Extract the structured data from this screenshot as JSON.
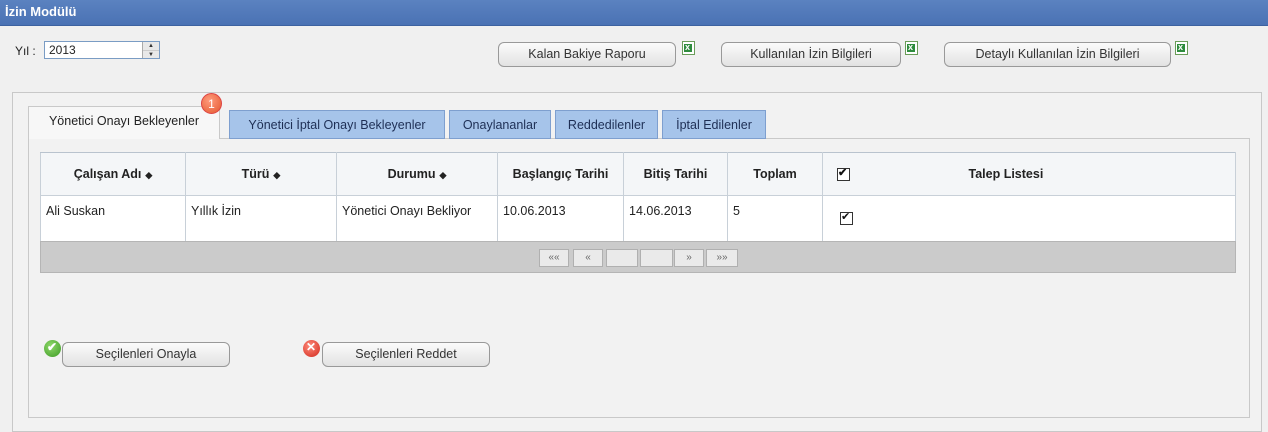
{
  "window": {
    "title": "İzin Modülü"
  },
  "filters": {
    "year_label": "Yıl :",
    "year_value": "2013"
  },
  "toolbar": {
    "btn_remaining": "Kalan Bakiye Raporu",
    "btn_used": "Kullanılan İzin Bilgileri",
    "btn_detailed": "Detaylı Kullanılan İzin Bilgileri"
  },
  "tabs": [
    {
      "label": "Yönetici Onayı Bekleyenler"
    },
    {
      "label": "Yönetici İptal Onayı Bekleyenler"
    },
    {
      "label": "Onaylananlar"
    },
    {
      "label": "Reddedilenler"
    },
    {
      "label": "İptal Edilenler"
    }
  ],
  "badge_count": "1",
  "table": {
    "columns": [
      "Çalışan Adı",
      "Türü",
      "Durumu",
      "Başlangıç Tarihi",
      "Bitiş Tarihi",
      "Toplam",
      "Talep Listesi"
    ],
    "rows": [
      {
        "employee": "Ali Suskan",
        "type": "Yıllık İzin",
        "status": "Yönetici Onayı Bekliyor",
        "start": "10.06.2013",
        "end": "14.06.2013",
        "total": "5"
      }
    ]
  },
  "pager": {
    "first": "««",
    "prev": "«",
    "next": "»",
    "last": "»»"
  },
  "actions": {
    "approve": "Seçilenleri Onayla",
    "reject": "Seçilenleri Reddet"
  },
  "colors": {
    "title_bar": "#4a72b4",
    "tab_inactive": "#a6c4ea"
  }
}
